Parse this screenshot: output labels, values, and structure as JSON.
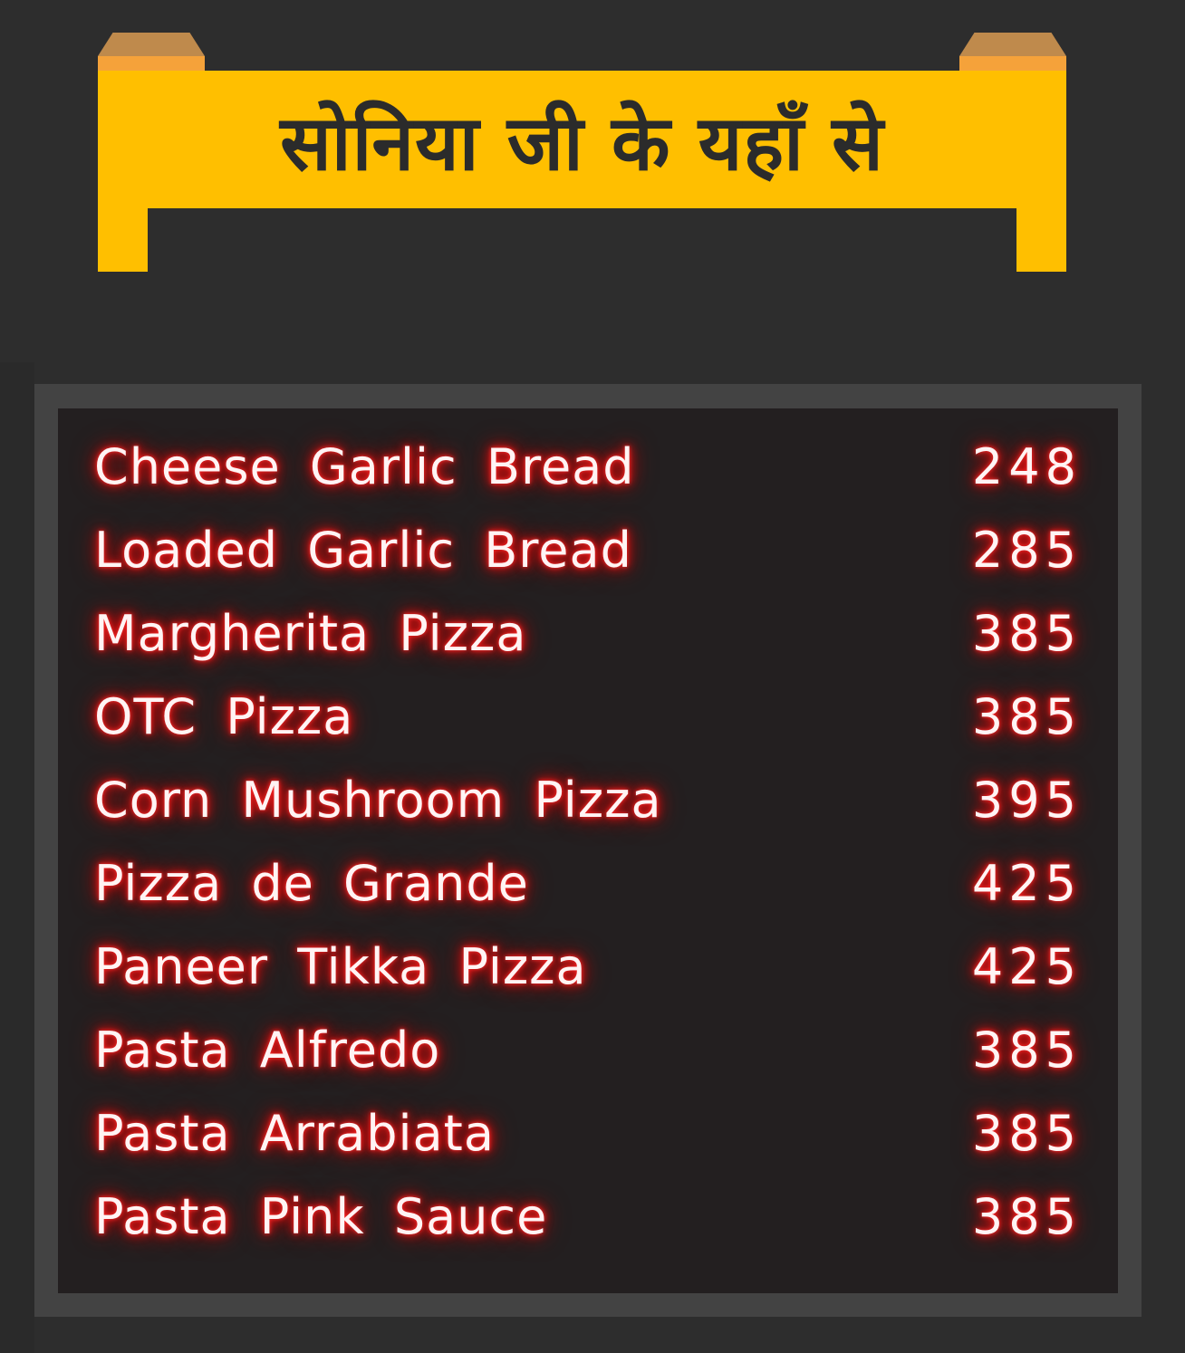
{
  "sign": {
    "title": "सोनिया जी के यहाँ से"
  },
  "colors": {
    "background": "#2d2d2d",
    "sign_yellow": "#ffbf00",
    "sign_cap_wood": "#bf8a4c",
    "sign_cap_band": "#f5a23a",
    "board_frame": "#434343",
    "board": "#231f20",
    "neon_glow": "#ff1a1a"
  },
  "menu": {
    "items": [
      {
        "name": "Cheese Garlic Bread",
        "price": "248"
      },
      {
        "name": "Loaded Garlic Bread",
        "price": "285"
      },
      {
        "name": "Margherita Pizza",
        "price": "385"
      },
      {
        "name": "OTC Pizza",
        "price": "385"
      },
      {
        "name": "Corn Mushroom Pizza",
        "price": "395"
      },
      {
        "name": "Pizza de Grande",
        "price": "425"
      },
      {
        "name": "Paneer Tikka Pizza",
        "price": "425"
      },
      {
        "name": "Pasta Alfredo",
        "price": "385"
      },
      {
        "name": "Pasta Arrabiata",
        "price": "385"
      },
      {
        "name": "Pasta Pink Sauce",
        "price": "385"
      }
    ]
  }
}
